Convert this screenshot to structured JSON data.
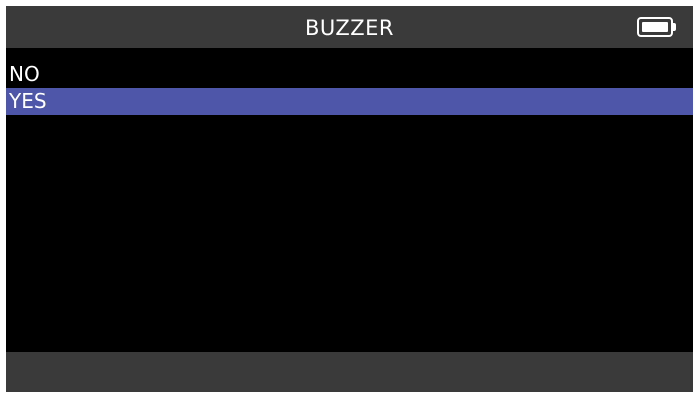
{
  "header": {
    "title": "BUZZER",
    "battery_icon": "battery-full-icon"
  },
  "menu": {
    "options": [
      {
        "label": "NO",
        "selected": false
      },
      {
        "label": "YES",
        "selected": true
      }
    ],
    "selected_highlight_color": "#4d56a8"
  },
  "colors": {
    "background": "#000000",
    "bar": "#3a3a3a",
    "text": "#ffffff"
  }
}
